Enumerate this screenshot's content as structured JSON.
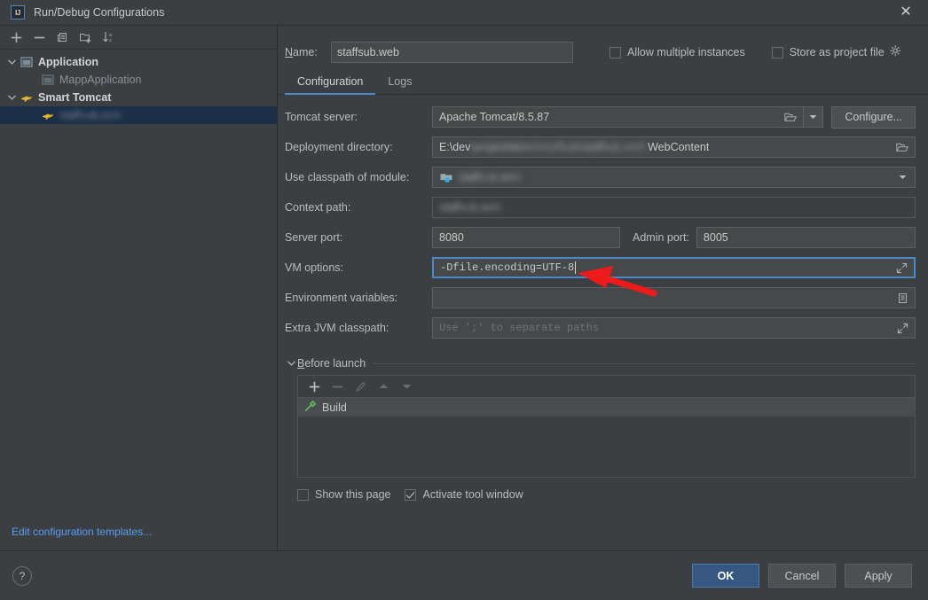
{
  "window": {
    "title": "Run/Debug Configurations",
    "logo_text": "IJ",
    "close_label": "✕"
  },
  "sidebar": {
    "toolbar": [
      {
        "name": "add-configuration-button",
        "icon": "plus-icon"
      },
      {
        "name": "remove-configuration-button",
        "icon": "minus-icon"
      },
      {
        "name": "copy-configuration-button",
        "icon": "copy-icon"
      },
      {
        "name": "new-folder-button",
        "icon": "folder-add-icon"
      },
      {
        "name": "sort-configurations-button",
        "icon": "sort-alpha-icon"
      }
    ],
    "tree": [
      {
        "label": "Application",
        "level": 1,
        "group": true,
        "icon": "application-icon",
        "expanded": true,
        "selected": false,
        "blurred": false
      },
      {
        "label": "MappApplication",
        "level": 2,
        "group": false,
        "icon": "application-icon",
        "expanded": null,
        "selected": false,
        "blurred": false
      },
      {
        "label": "Smart Tomcat",
        "level": 1,
        "group": true,
        "icon": "tomcat-icon",
        "expanded": true,
        "selected": false,
        "blurred": false
      },
      {
        "label": "staffsub.web",
        "level": 2,
        "group": false,
        "icon": "tomcat-icon",
        "expanded": null,
        "selected": true,
        "blurred": true
      }
    ],
    "edit_templates_link": "Edit configuration templates..."
  },
  "main": {
    "name_label": "Name:",
    "name_value": "staffsub.web",
    "options": [
      {
        "label": "Allow multiple instances",
        "checked": false,
        "name": "allow-multiple-instances-checkbox"
      },
      {
        "label": "Store as project file",
        "checked": false,
        "name": "store-as-project-file-checkbox"
      }
    ],
    "tabs": [
      {
        "label": "Configuration",
        "active": true
      },
      {
        "label": "Logs",
        "active": false
      }
    ],
    "fields": {
      "tomcat_server": {
        "label": "Tomcat server:",
        "value": "Apache Tomcat/8.5.87"
      },
      "configure_button": "Configure...",
      "deployment_directory": {
        "label": "Deployment directory:",
        "prefix": "E:\\dev",
        "blurred_mid": "\\project\\demo\\staffsub\\staffsub.web\\",
        "suffix": "WebContent"
      },
      "use_classpath_of_module": {
        "label": "Use classpath of module:",
        "value": "staffsub.web",
        "blurred": true
      },
      "context_path": {
        "label": "Context path:",
        "value": "staffsub.web",
        "blurred": true
      },
      "server_port": {
        "label": "Server port:",
        "value": "8080"
      },
      "admin_port": {
        "label": "Admin port:",
        "value": "8005"
      },
      "vm_options": {
        "label": "VM options:",
        "value": "-Dfile.encoding=UTF-8",
        "focused": true
      },
      "environment_variables": {
        "label": "Environment variables:",
        "value": ""
      },
      "extra_jvm_classpath": {
        "label": "Extra JVM classpath:",
        "placeholder": "Use ';' to separate paths"
      }
    },
    "before_launch": {
      "title": "Before launch",
      "toolbar": [
        {
          "name": "add-task-button",
          "icon": "plus-icon",
          "enabled": true
        },
        {
          "name": "remove-task-button",
          "icon": "minus-icon",
          "enabled": false
        },
        {
          "name": "edit-task-button",
          "icon": "pencil-icon",
          "enabled": false
        },
        {
          "name": "move-task-up-button",
          "icon": "arrow-up-icon",
          "enabled": false
        },
        {
          "name": "move-task-down-button",
          "icon": "arrow-down-icon",
          "enabled": false
        }
      ],
      "tasks": [
        {
          "label": "Build",
          "icon": "build-hammer-icon"
        }
      ]
    },
    "bottom_options": [
      {
        "label": "Show this page",
        "checked": false,
        "name": "show-this-page-checkbox"
      },
      {
        "label": "Activate tool window",
        "checked": true,
        "name": "activate-tool-window-checkbox"
      }
    ]
  },
  "footer": {
    "help_label": "?",
    "buttons": [
      {
        "label": "OK",
        "primary": true,
        "name": "ok-button"
      },
      {
        "label": "Cancel",
        "primary": false,
        "name": "cancel-button"
      },
      {
        "label": "Apply",
        "primary": false,
        "name": "apply-button"
      }
    ]
  },
  "annotation": {
    "type": "red-arrow",
    "color": "#ee1b1b",
    "points_to": "vm-options-field"
  },
  "colors": {
    "window_bg": "#3c3f41",
    "field_bg": "#45494a",
    "accent_blue": "#4a88c7",
    "selection_blue": "#1b3048",
    "link_blue": "#589df6",
    "primary_button": "#365880",
    "annotation_red": "#ee1b1b"
  }
}
